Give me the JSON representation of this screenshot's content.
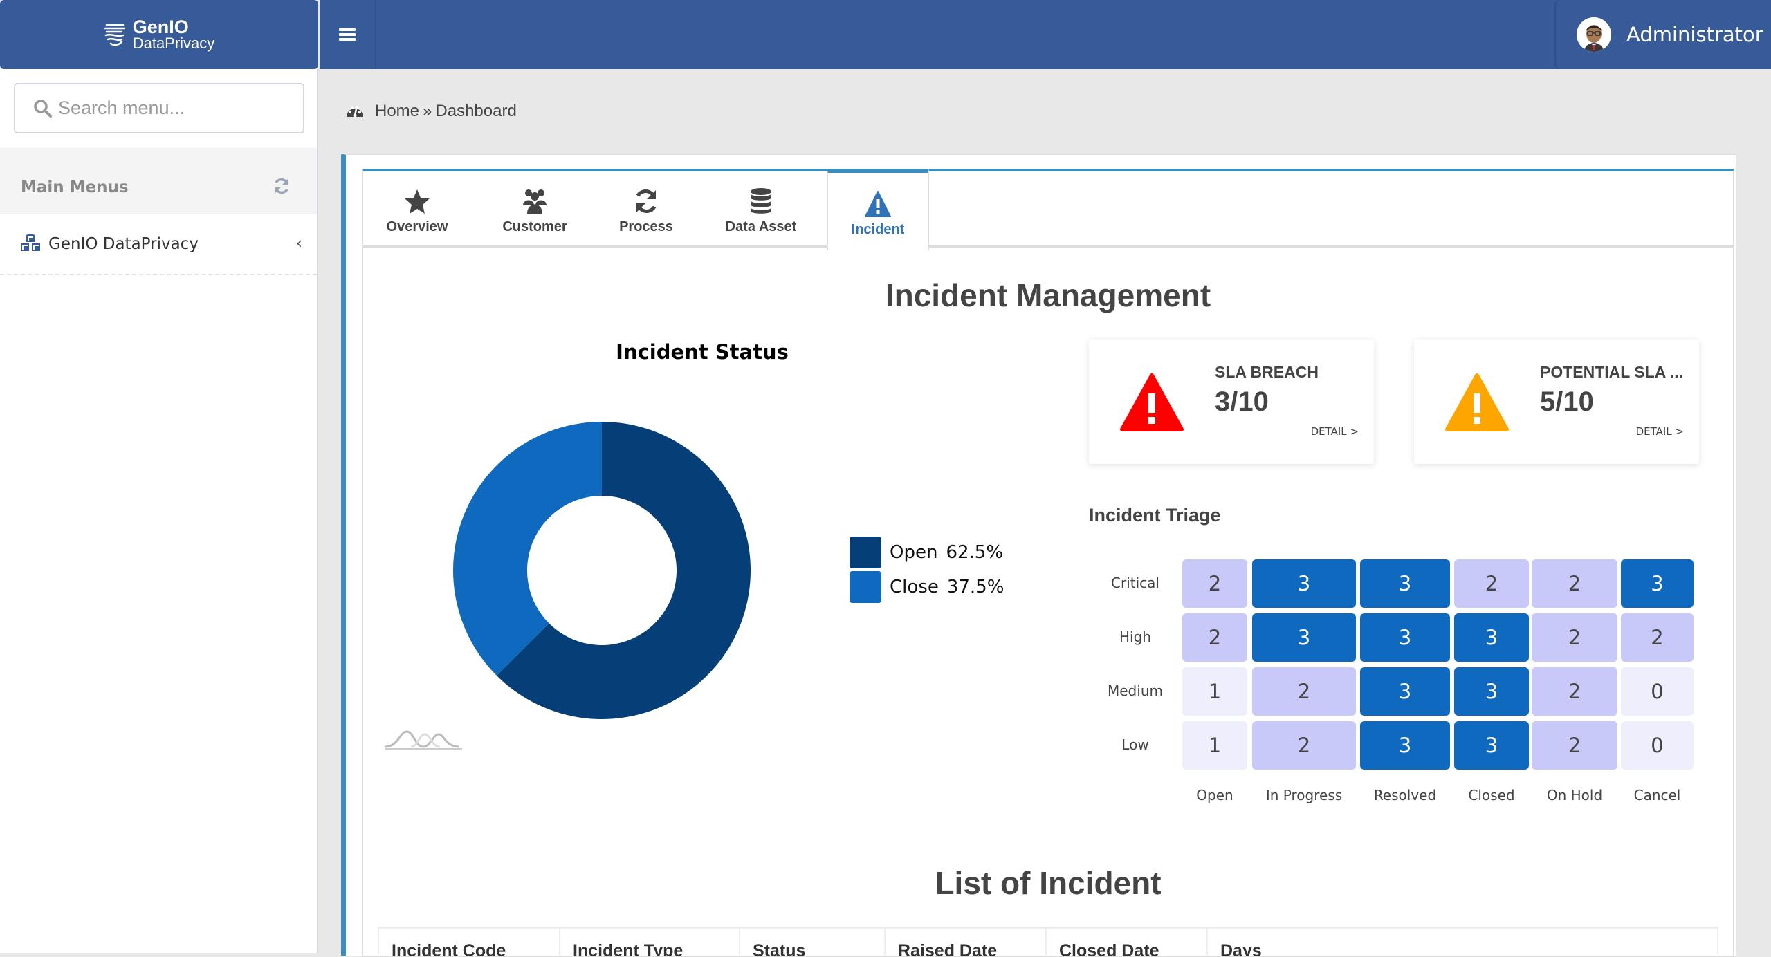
{
  "header": {
    "logo_line1": "GenIO",
    "logo_line2": "DataPrivacy",
    "menu_toggle_icon": "hamburger-icon",
    "user_name": "Administrator",
    "user_avatar_icon": "user-avatar"
  },
  "sidebar": {
    "search_placeholder": "Search menu...",
    "search_value": "",
    "menu_title": "Main Menus",
    "items": [
      {
        "label": "GenIO DataPrivacy",
        "icon": "cubes-icon",
        "expand_icon": "chevron-left-icon"
      }
    ]
  },
  "breadcrumb": {
    "icon": "dashboard-icon",
    "home": "Home",
    "separator": "»",
    "current": "Dashboard"
  },
  "tabs": [
    {
      "label": "Overview",
      "icon": "star-icon",
      "active": false
    },
    {
      "label": "Customer",
      "icon": "users-icon",
      "active": false
    },
    {
      "label": "Process",
      "icon": "refresh-icon",
      "active": false
    },
    {
      "label": "Data Asset",
      "icon": "database-icon",
      "active": false
    },
    {
      "label": "Incident",
      "icon": "warning-icon",
      "active": true
    }
  ],
  "main": {
    "title": "Incident Management",
    "cards": [
      {
        "title": "SLA BREACH",
        "value": "3/10",
        "detail": "DETAIL >",
        "color": "#ff0000"
      },
      {
        "title": "POTENTIAL SLA ...",
        "value": "5/10",
        "detail": "DETAIL >",
        "color": "#ffa500"
      }
    ],
    "list_title": "List of Incident",
    "table_headers": [
      "Incident Code",
      "Incident Type",
      "Status",
      "Raised Date",
      "Closed Date",
      "Days"
    ]
  },
  "chart_data": [
    {
      "type": "pie",
      "title": "Incident Status",
      "donut": true,
      "categories": [
        "Open",
        "Close"
      ],
      "values": [
        62.5,
        37.5
      ],
      "labels": [
        "62.5%",
        "37.5%"
      ],
      "colors": [
        "#063f77",
        "#0f69bf"
      ],
      "legend": "right"
    },
    {
      "type": "heatmap",
      "title": "Incident Triage",
      "x": [
        "Open",
        "In Progress",
        "Resolved",
        "Closed",
        "On Hold",
        "Cancel"
      ],
      "y": [
        "Critical",
        "High",
        "Medium",
        "Low"
      ],
      "values": [
        [
          2,
          3,
          3,
          2,
          2,
          3
        ],
        [
          2,
          3,
          3,
          3,
          2,
          2
        ],
        [
          1,
          2,
          3,
          3,
          2,
          0
        ],
        [
          1,
          2,
          3,
          3,
          2,
          0
        ]
      ],
      "color_scale": {
        "0": "#eeeefd",
        "1": "#eeeefd",
        "2": "#c8c8f9",
        "3": "#0f69bf"
      }
    }
  ]
}
